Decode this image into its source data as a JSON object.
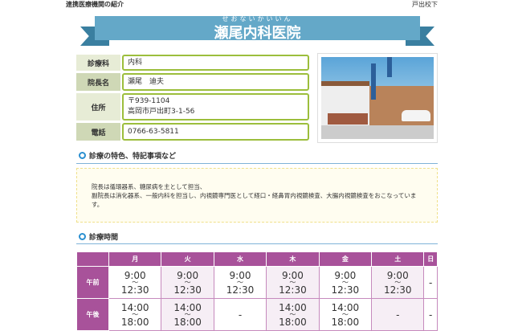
{
  "header": {
    "section_title": "連携医療機関の紹介",
    "area": "戸出校下"
  },
  "clinic": {
    "ruby": "せおないかいいん",
    "name": "瀬尾内科医院"
  },
  "info": [
    {
      "label": "診療科",
      "value": [
        "内科"
      ]
    },
    {
      "label": "院長名",
      "value": [
        "瀬尾　迪夫"
      ]
    },
    {
      "label": "住所",
      "value": [
        "〒939-1104",
        "高岡市戸出町3-1-56"
      ]
    },
    {
      "label": "電話",
      "value": [
        "0766-63-5811"
      ]
    }
  ],
  "features": {
    "heading": "診療の特色、特記事項など",
    "lines": [
      "院長は循環器系、糖尿病を主として担当、",
      "副院長は消化器系、一般内科を担当し、内視鏡専門医として経口・経鼻胃内視鏡検査、大腸内視鏡検査をおこなっています。"
    ]
  },
  "hours": {
    "heading": "診療時間",
    "days": [
      "月",
      "火",
      "水",
      "木",
      "金",
      "土",
      "日"
    ],
    "tilde": "〜",
    "rows": [
      {
        "label": "午前",
        "cells": [
          [
            "9:00",
            "12:30"
          ],
          [
            "9:00",
            "12:30"
          ],
          [
            "9:00",
            "12:30"
          ],
          [
            "9:00",
            "12:30"
          ],
          [
            "9:00",
            "12:30"
          ],
          [
            "9:00",
            "12:30"
          ],
          [
            "-"
          ]
        ]
      },
      {
        "label": "午後",
        "cells": [
          [
            "14:00",
            "18:00"
          ],
          [
            "14:00",
            "18:00"
          ],
          [
            "-"
          ],
          [
            "14:00",
            "18:00"
          ],
          [
            "14:00",
            "18:00"
          ],
          [
            "-"
          ],
          [
            "-"
          ]
        ]
      }
    ]
  },
  "colors": {
    "banner": "#64a8c8",
    "table_header": "#a8529a",
    "field_border": "#9cbe3c"
  }
}
